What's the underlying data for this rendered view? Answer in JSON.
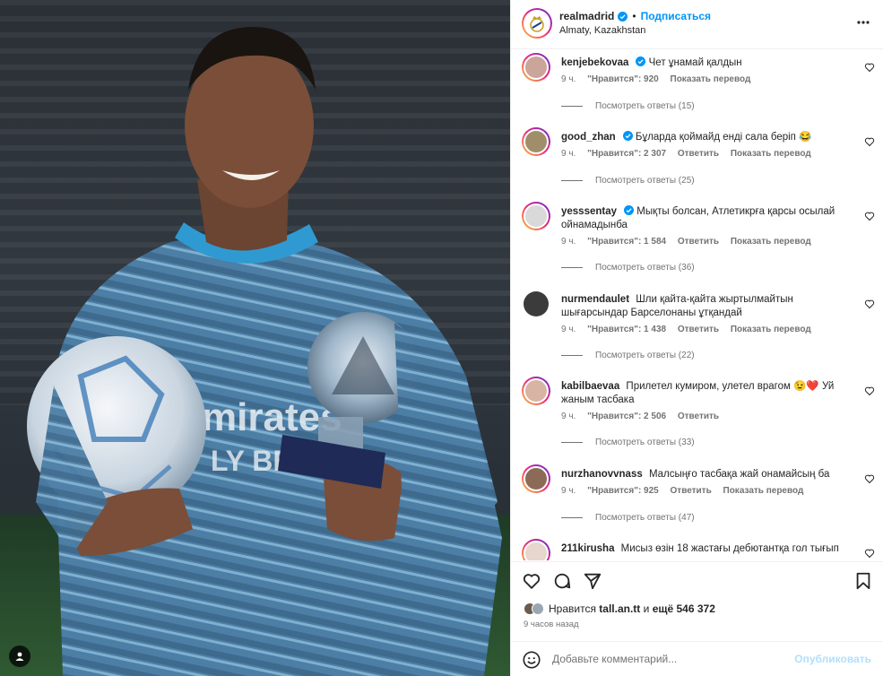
{
  "post": {
    "username": "realmadrid",
    "separator": "•",
    "follow_label": "Подписаться",
    "location": "Almaty, Kazakhstan",
    "more_icon": "more-horizontal-icon"
  },
  "comments": [
    {
      "username": "kenjebekovaa",
      "verified": true,
      "text": "Чет ұнамай қалдын",
      "time": "9 ч.",
      "likes": "\"Нравится\": 920",
      "reply": "",
      "translate": "Показать перевод",
      "replies": "Посмотреть ответы (15)",
      "avatar_color": "#caa59a"
    },
    {
      "username": "good_zhan",
      "verified": true,
      "text": "Бұларда қоймайд енді сала беріп 😂",
      "time": "9 ч.",
      "likes": "\"Нравится\": 2 307",
      "reply": "Ответить",
      "translate": "Показать перевод",
      "replies": "Посмотреть ответы (25)",
      "avatar_color": "#a08e6a"
    },
    {
      "username": "yesssentay",
      "verified": true,
      "text": "Мықты болсан, Атлетикрға қарсы осылай ойнамадынба",
      "time": "9 ч.",
      "likes": "\"Нравится\": 1 584",
      "reply": "Ответить",
      "translate": "Показать перевод",
      "replies": "Посмотреть ответы (36)",
      "avatar_color": "#d9d9d9"
    },
    {
      "username": "nurmendaulet",
      "verified": false,
      "text": "Шли қайта-қайта жыртылмайтын шығарсындар Барселонаны ұтқандай",
      "time": "9 ч.",
      "likes": "\"Нравится\": 1 438",
      "reply": "Ответить",
      "translate": "Показать перевод",
      "replies": "Посмотреть ответы (22)",
      "avatar_color": "#3b3b3b"
    },
    {
      "username": "kabilbaevaa",
      "verified": false,
      "text": "Прилетел кумиром, улетел врагом 😉❤️ Уй жаным тасбака",
      "time": "9 ч.",
      "likes": "\"Нравится\": 2 506",
      "reply": "Ответить",
      "translate": "",
      "replies": "Посмотреть ответы (33)",
      "avatar_color": "#d8b4a4"
    },
    {
      "username": "nurzhanovvnass",
      "verified": false,
      "text": "Малсыңғо тасбақа жай онамайсың ба",
      "time": "9 ч.",
      "likes": "\"Нравится\": 925",
      "reply": "Ответить",
      "translate": "Показать перевод",
      "replies": "Посмотреть ответы (47)",
      "avatar_color": "#8b6b58"
    },
    {
      "username": "211kirusha",
      "verified": false,
      "text": "Мисыз өзін 18 жастағы дебютантқа гол тығып",
      "time": "",
      "likes": "",
      "reply": "",
      "translate": "",
      "replies": "",
      "avatar_color": "#e6d6cc"
    }
  ],
  "actions": {
    "like_icon": "heart-icon",
    "comment_icon": "comment-icon",
    "share_icon": "share-icon",
    "save_icon": "bookmark-icon"
  },
  "likes": {
    "prefix": "Нравится",
    "user": "tall.an.tt",
    "middle": "и",
    "count": "ещё 546 372"
  },
  "time_ago": "9 часов назад",
  "add_comment": {
    "placeholder": "Добавьте комментарий...",
    "post_label": "Опубликовать"
  }
}
